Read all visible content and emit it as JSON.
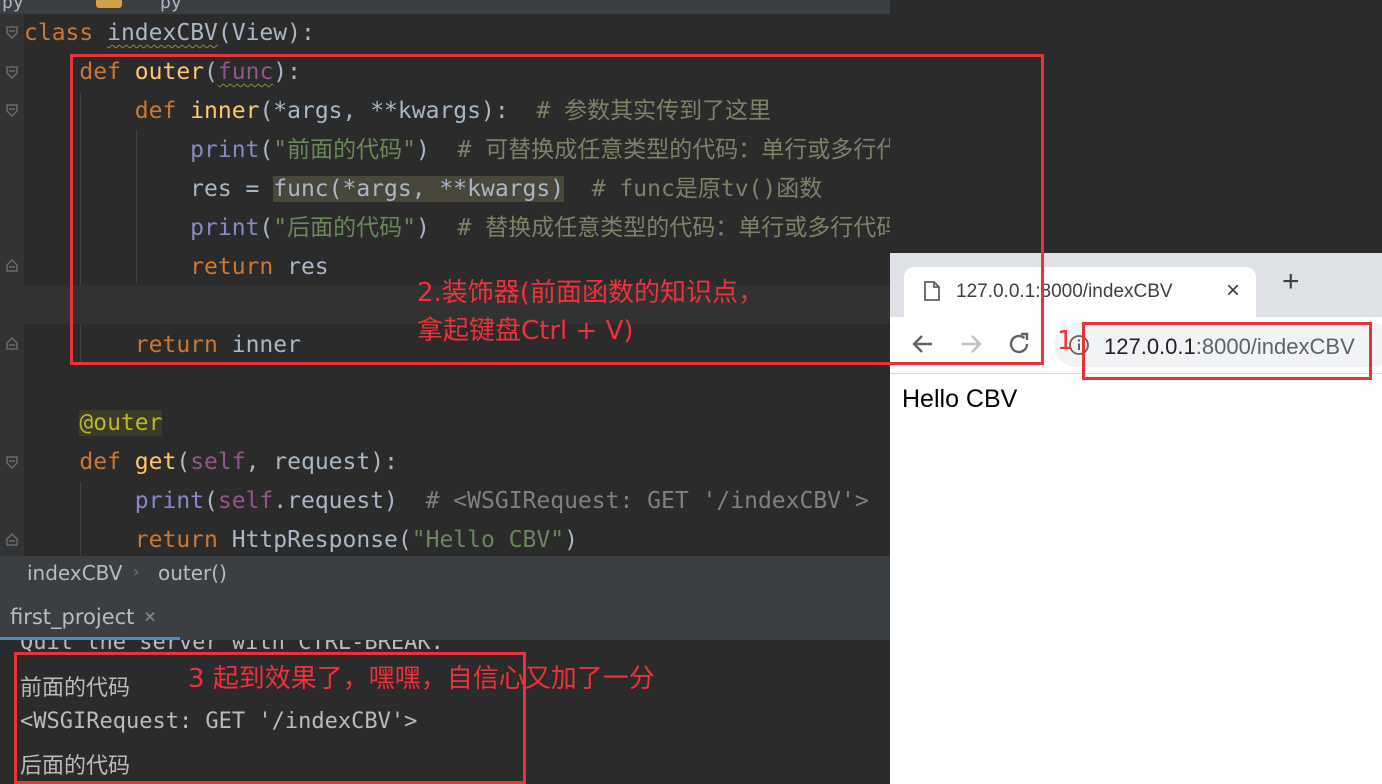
{
  "editor": {
    "tab_fragment_1": "py",
    "tab_fragment_2": "py",
    "code": {
      "l1_kw": "class",
      "l1_name": "indexCBV",
      "l1_rest": "(View):",
      "l2_kw": "def",
      "l2_name": "outer",
      "l2_open": "(",
      "l2_arg": "func",
      "l2_close": "):",
      "l3_kw": "def",
      "l3_name": "inner",
      "l3_args": "(*args, **kwargs):  ",
      "l3_comment": "# 参数其实传到了这里",
      "l4_fn": "print",
      "l4_open": "(",
      "l4_str": "\"前面的代码\"",
      "l4_close": ")  ",
      "l4_comment": "# 可替换成任意类型的代码：单行或多行代码、函数、类等",
      "l5_pre": "res = ",
      "l5_call": "func(*args, **kwargs)",
      "l5_mid": "  ",
      "l5_comment": "# func是原tv()函数",
      "l6_fn": "print",
      "l6_open": "(",
      "l6_str": "\"后面的代码\"",
      "l6_close": ")  ",
      "l6_comment": "# 替换成任意类型的代码：单行或多行代码、函数、类等",
      "l7_kw": "return",
      "l7_rest": " res",
      "l9_kw": "return",
      "l9_rest": " inner",
      "l11_deco": "@outer",
      "l12_kw": "def",
      "l12_name": "get",
      "l12_open": "(",
      "l12_self": "self",
      "l12_rest": ", request):",
      "l13_fn": "print",
      "l13_open": "(",
      "l13_self": "self",
      "l13_rest": ".request)  ",
      "l13_comment": "# <WSGIRequest: GET '/indexCBV'>",
      "l14_kw": "return",
      "l14_rest": " HttpResponse(",
      "l14_str": "\"Hello CBV\"",
      "l14_close": ")"
    }
  },
  "breadcrumb": {
    "class_name": "indexCBV",
    "separator": "›",
    "method_name": "outer()"
  },
  "run": {
    "tab_label": "first_project",
    "close_glyph": "×",
    "console_lines": [
      "Quit the server with CTRL-BREAK.",
      "前面的代码",
      "<WSGIRequest: GET '/indexCBV'>",
      "后面的代码"
    ]
  },
  "browser": {
    "tab_title": "127.0.0.1:8000/indexCBV",
    "close_glyph": "×",
    "new_tab_glyph": "+",
    "url_host": "127.0.0.1",
    "url_rest": ":8000/indexCBV",
    "page_text": "Hello CBV"
  },
  "annotations": {
    "note_1": "1",
    "note_2_line1": "2.装饰器(前面函数的知识点，",
    "note_2_line2": "拿起键盘Ctrl + V)",
    "note_3": "3 起到效果了，嘿嘿，自信心又加了一分",
    "color": "#f0303a"
  }
}
